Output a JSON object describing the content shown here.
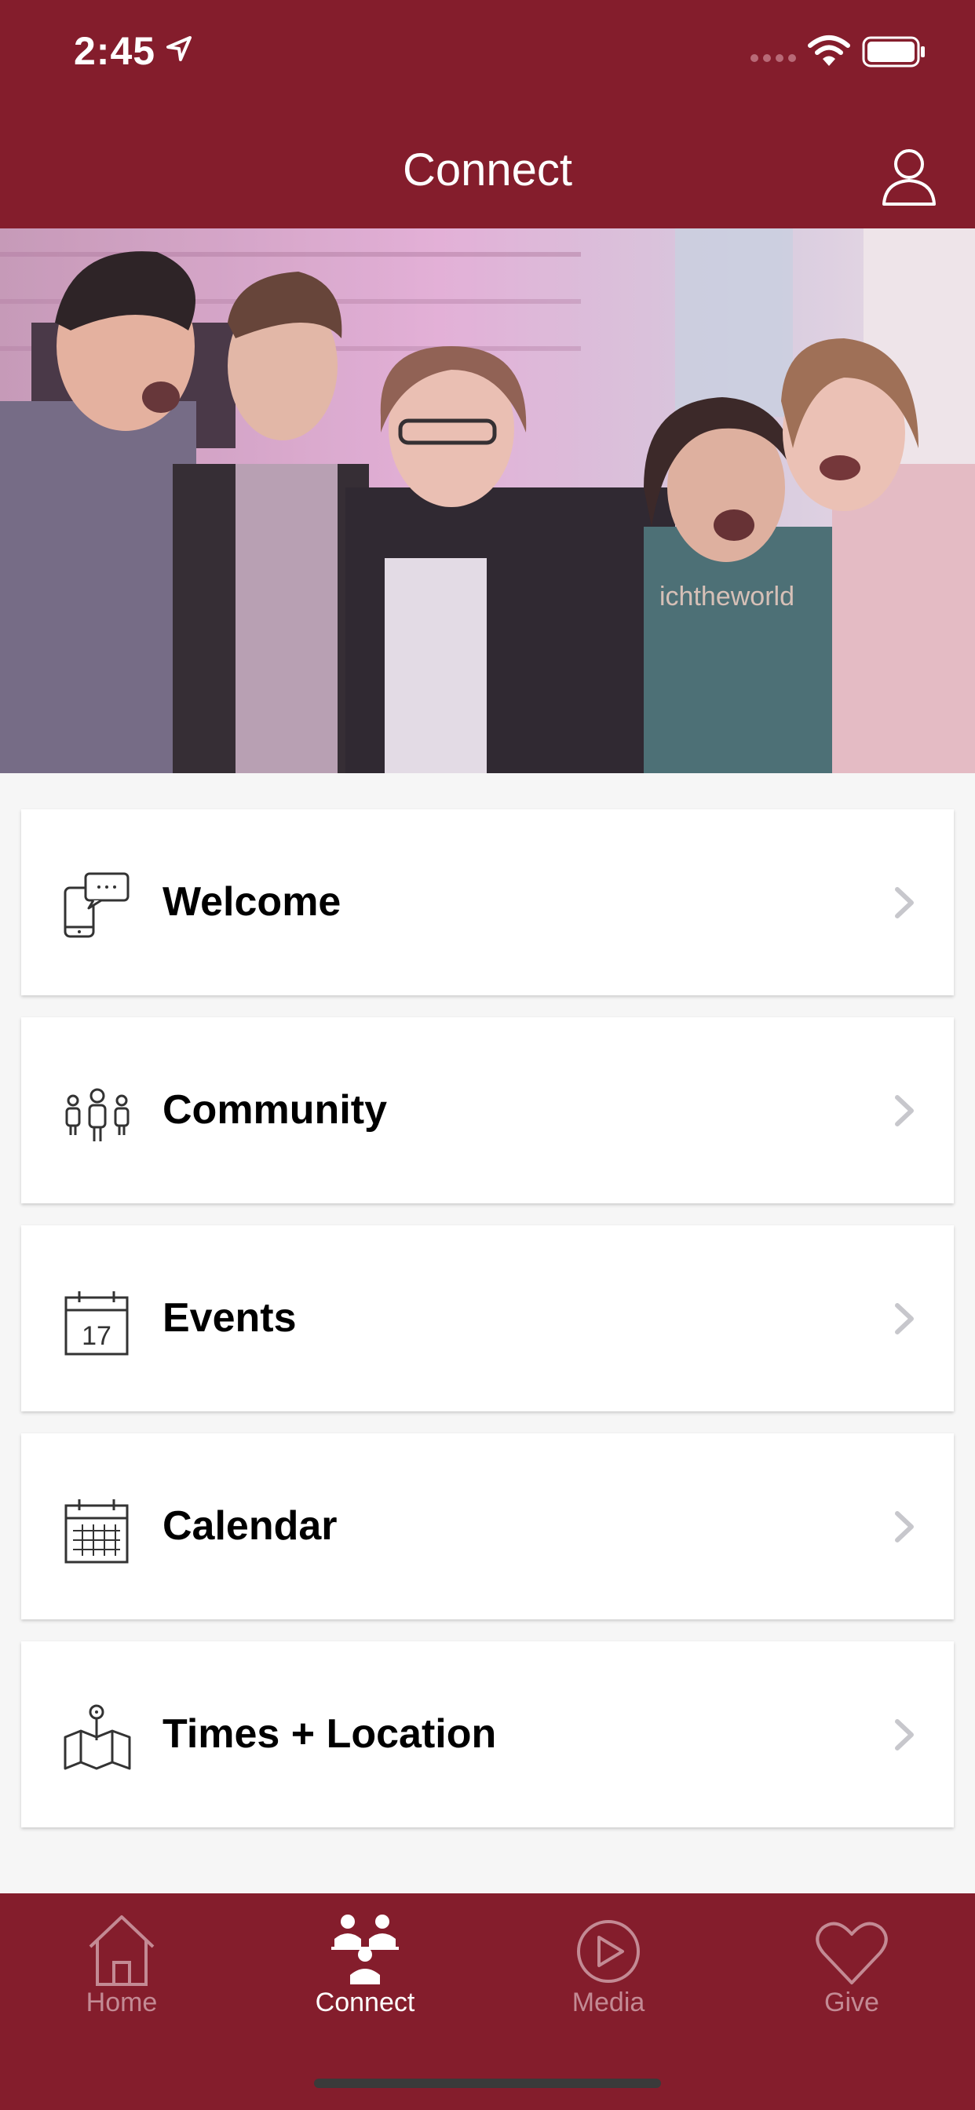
{
  "status_bar": {
    "time": "2:45"
  },
  "header": {
    "title": "Connect"
  },
  "menu": [
    {
      "label": "Welcome",
      "icon": "welcome-icon"
    },
    {
      "label": "Community",
      "icon": "community-icon"
    },
    {
      "label": "Events",
      "icon": "events-icon",
      "icon_text": "17"
    },
    {
      "label": "Calendar",
      "icon": "calendar-icon"
    },
    {
      "label": "Times + Location",
      "icon": "map-pin-icon"
    }
  ],
  "tabs": [
    {
      "label": "Home",
      "icon": "home-icon",
      "active": false
    },
    {
      "label": "Connect",
      "icon": "connect-icon",
      "active": true
    },
    {
      "label": "Media",
      "icon": "play-icon",
      "active": false
    },
    {
      "label": "Give",
      "icon": "heart-icon",
      "active": false
    }
  ],
  "hero_image": {
    "text": "ichtheworld"
  },
  "colors": {
    "brand": "#841d2c",
    "tab_inactive": "#c38a94",
    "background": "#f6f6f6"
  }
}
